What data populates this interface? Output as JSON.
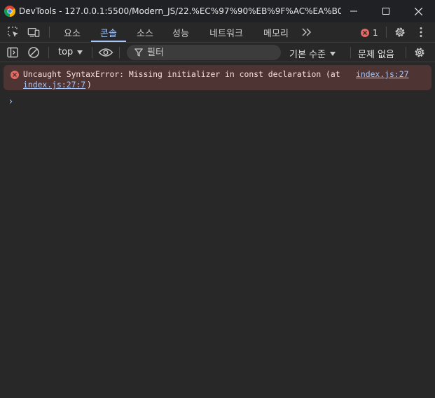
{
  "window": {
    "title": "DevTools - 127.0.0.1:5500/Modern_JS/22.%EC%97%90%EB%9F%AC%EA%B0%9D%...",
    "controls": [
      "minimize",
      "maximize",
      "close"
    ]
  },
  "tabs": [
    {
      "label": "요소",
      "active": false
    },
    {
      "label": "콘솔",
      "active": true
    },
    {
      "label": "소스",
      "active": false
    },
    {
      "label": "성능",
      "active": false
    },
    {
      "label": "네트워크",
      "active": false
    },
    {
      "label": "메모리",
      "active": false
    }
  ],
  "error_count": "1",
  "toolbar": {
    "context": "top",
    "filter_placeholder": "필터",
    "levels": "기본 수준",
    "issues": "문제 없음"
  },
  "console": {
    "error_text": "Uncaught SyntaxError: Missing initializer in const declaration (at",
    "error_link": "index.js:27",
    "error_link_full": "index.js:27:7",
    "error_close": ")",
    "prompt": "›"
  },
  "colors": {
    "accent": "#a8c7fa",
    "error": "#e46962",
    "error_bg": "#4e3534",
    "background": "#282828"
  }
}
